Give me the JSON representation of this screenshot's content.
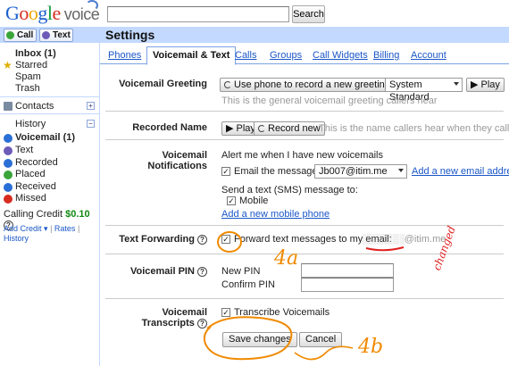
{
  "logo": {
    "letters": [
      "G",
      "o",
      "o",
      "g",
      "l",
      "e"
    ],
    "product": "voice"
  },
  "search": {
    "button": "Search"
  },
  "sidebar": {
    "call_label": "Call",
    "text_label": "Text",
    "inbox": "Inbox (1)",
    "starred": "Starred",
    "spam": "Spam",
    "trash": "Trash",
    "contacts": "Contacts",
    "history": "History",
    "voicemail": "Voicemail (1)",
    "text": "Text",
    "recorded": "Recorded",
    "placed": "Placed",
    "received": "Received",
    "missed": "Missed",
    "credit_label": "Calling Credit",
    "credit_amount": "$0.10",
    "add_credit": "Add Credit ▾",
    "rates": "Rates",
    "history_link": "History"
  },
  "page": {
    "title": "Settings"
  },
  "tabs": [
    "Phones",
    "Voicemail & Text",
    "Calls",
    "Groups",
    "Call Widgets",
    "Billing",
    "Account"
  ],
  "voicemail_greeting": {
    "label": "Voicemail Greeting",
    "record_button": "Use phone to record a new greeting",
    "select_value": "System Standard",
    "play": "Play",
    "hint": "This is the general voicemail greeting callers hear"
  },
  "recorded_name": {
    "label": "Recorded Name",
    "play": "Play",
    "record_button": "Record new",
    "hint": "This is the name callers hear when they call you"
  },
  "notifications": {
    "label": "Voicemail Notifications",
    "alert_text": "Alert me when I have new voicemails",
    "email_label": "Email the message to:",
    "email_value": "Jb007@itim.me",
    "add_email": "Add a new email address",
    "sms_text": "Send a text (SMS) message to:",
    "mobile": "Mobile",
    "add_mobile": "Add a new mobile phone"
  },
  "text_forwarding": {
    "label": "Text Forwarding",
    "text": "Forward text messages to my email:",
    "email_masked": "░░░░░░@itim.me"
  },
  "voicemail_pin": {
    "label": "Voicemail PIN",
    "new_pin": "New PIN",
    "confirm_pin": "Confirm PIN"
  },
  "transcripts": {
    "label": "Voicemail Transcripts",
    "text": "Transcribe Voicemails"
  },
  "actions": {
    "save": "Save changes",
    "cancel": "Cancel"
  },
  "annotations": {
    "a": "4a",
    "b": "4b",
    "changed": "changed"
  },
  "colors": {
    "accent": "#c3d9ff",
    "link": "#1a56c7",
    "annotation_orange": "#f08a00",
    "annotation_red": "#e02020"
  }
}
